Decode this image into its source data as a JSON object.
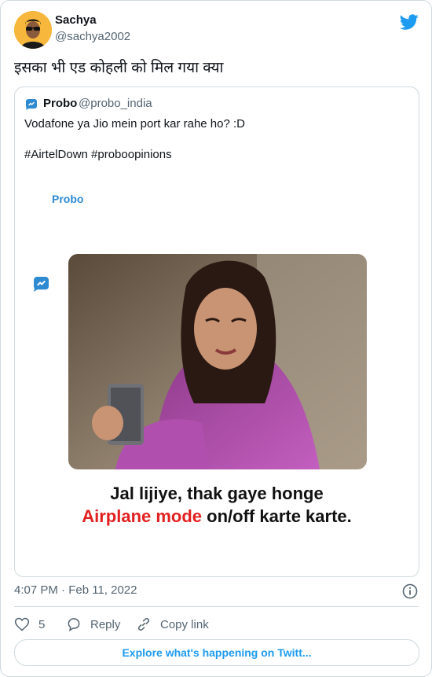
{
  "colors": {
    "twitter_blue": "#1d9bf0",
    "secondary_text": "#536471",
    "border": "#cfd9de",
    "caption_red": "#e32020",
    "probo_blue": "#2e8ad1"
  },
  "author": {
    "name": "Sachya",
    "handle": "@sachya2002",
    "avatar_icon": "avatar-icon"
  },
  "tweet": {
    "text": "इसका भी एड कोहली को मिल गया क्या"
  },
  "quoted": {
    "name": "Probo",
    "handle": "@probo_india",
    "line1": "Vodafone ya Jio mein port kar rahe ho? :D",
    "line2": "#AirtelDown #proboopinions",
    "media": {
      "logo_text": "Probo",
      "caption_line1": "Jal lijiye, thak gaye honge",
      "caption_line2_red": "Airplane mode",
      "caption_line2_rest": " on/off karte karte."
    }
  },
  "timestamp": "4:07 PM · Feb 11, 2022",
  "actions": {
    "likes": "5",
    "reply_label": "Reply",
    "copy_label": "Copy link"
  },
  "explore_label": "Explore what's happening on Twitt..."
}
